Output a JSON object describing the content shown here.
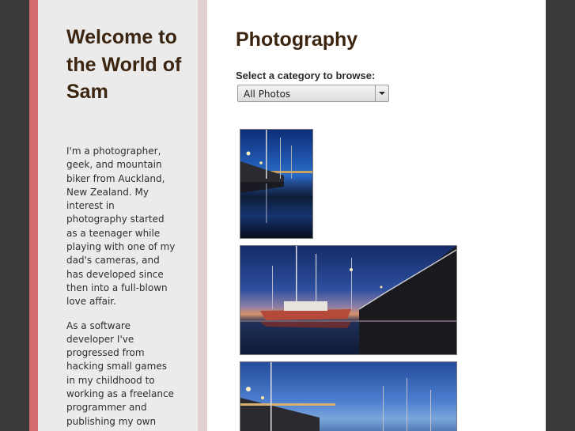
{
  "sidebar": {
    "title": "Welcome to the World of Sam",
    "bio_paragraphs": [
      "I'm a photographer, geek, and mountain biker from Auckland, New Zealand. My interest in photography started as a teenager while playing with one of my dad's cameras, and has developed since then into a full-blown love affair.",
      "As a software developer I've progressed from hacking small games in my childhood to working as a freelance programmer and publishing my own"
    ]
  },
  "main": {
    "title": "Photography",
    "browse_label": "Select a category to browse:",
    "category_select": {
      "selected": "All Photos"
    }
  },
  "colors": {
    "background": "#3a3a3a",
    "sidebar_accent": "#d26a6f",
    "sidebar_bg": "#ebebeb",
    "sidebar_edge": "#e2cfcf",
    "heading": "#3b2410"
  }
}
